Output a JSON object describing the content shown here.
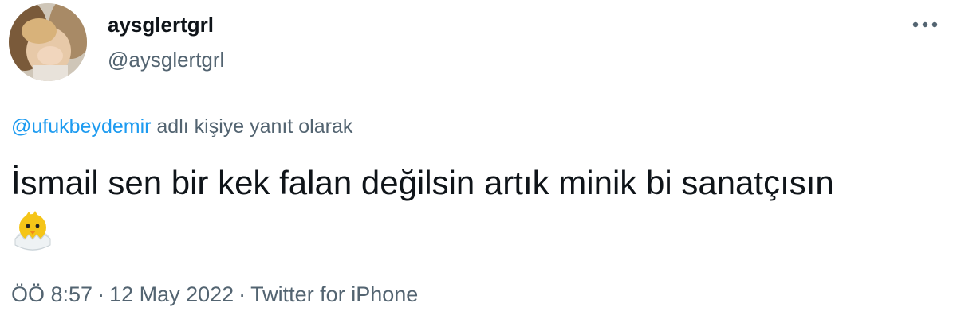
{
  "author": {
    "display_name": "aysglertgrl",
    "handle": "@aysglertgrl",
    "avatar": "profile-photo"
  },
  "more_icon": "ellipsis-icon",
  "reply": {
    "mention": "@ufukbeydemir",
    "suffix": " adlı kişiye yanıt olarak"
  },
  "tweet": {
    "text": "İsmail sen bir kek falan değilsin artık minik bi sanatçısın",
    "emoji": "hatching-chick-emoji"
  },
  "meta": {
    "time": "ÖÖ 8:57",
    "separator": "·",
    "date": "12 May 2022",
    "source": "Twitter for iPhone"
  },
  "colors": {
    "text": "#0f1419",
    "secondary": "#536471",
    "link": "#1d9bf0"
  }
}
